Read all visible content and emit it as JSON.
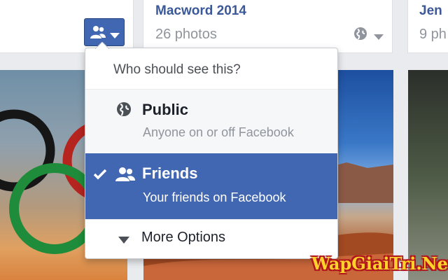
{
  "albums": [
    {
      "title": "",
      "count": ""
    },
    {
      "title": "Macword 2014",
      "count": "26 photos"
    },
    {
      "title": "Jen",
      "count": "9 ph"
    }
  ],
  "privacy_menu": {
    "header": "Who should see this?",
    "selected": "Friends",
    "options": [
      {
        "label": "Public",
        "description": "Anyone on or off Facebook",
        "icon": "globe-icon"
      },
      {
        "label": "Friends",
        "description": "Your friends on Facebook",
        "icon": "friends-icon"
      }
    ],
    "more_options": "More Options"
  },
  "audience_button": {
    "icon": "friends-icon",
    "selected": "Friends"
  },
  "colors": {
    "brand": "#3b5998",
    "selected_bg": "#4267b2",
    "muted": "#90949c"
  },
  "watermark": "WapGiaiTri.Net"
}
